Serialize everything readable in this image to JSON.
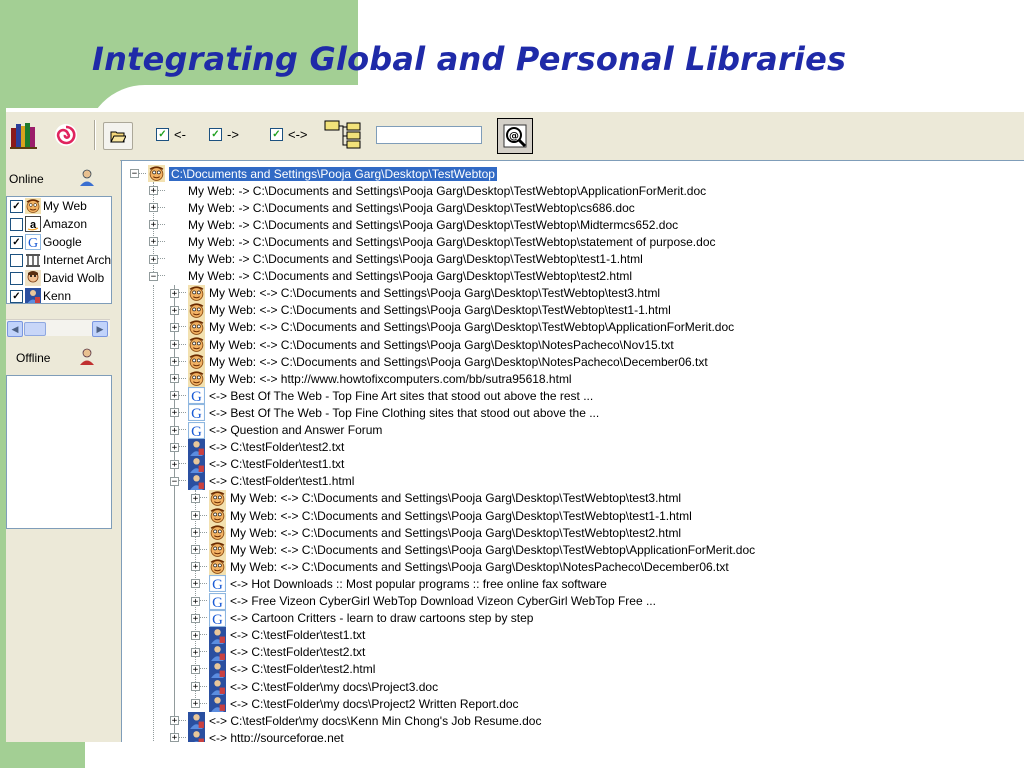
{
  "slide": {
    "title": "Integrating Global and Personal Libraries"
  },
  "toolbar": {
    "books_icon": "books-icon",
    "swirl_icon": "swirl-icon",
    "open_icon": "open-folder-icon",
    "check_left_label": "<-",
    "check_right_label": "->",
    "check_both_label": "<->",
    "tree_icon": "tree-view-icon",
    "search_value": "",
    "search_icon": "search-at-icon"
  },
  "left_panel": {
    "online_label": "Online",
    "offline_label": "Offline",
    "online_items": [
      {
        "label": "My Web",
        "checked": true,
        "icon": "myweb-face-icon"
      },
      {
        "label": "Amazon",
        "checked": false,
        "icon": "amazon-icon"
      },
      {
        "label": "Google",
        "checked": true,
        "icon": "google-icon"
      },
      {
        "label": "Internet Arch",
        "checked": false,
        "icon": "archive-icon"
      },
      {
        "label": "David Wolb",
        "checked": false,
        "icon": "person-icon"
      },
      {
        "label": "Kenn",
        "checked": true,
        "icon": "user-icon"
      }
    ]
  },
  "tree": {
    "rows": [
      {
        "level": 0,
        "exp": "-",
        "icon": "face",
        "text": "C:\\Documents and Settings\\Pooja Garg\\Desktop\\TestWebtop",
        "selected": true
      },
      {
        "level": 1,
        "exp": "+",
        "icon": "none",
        "text": "My Web:  -> C:\\Documents and Settings\\Pooja Garg\\Desktop\\TestWebtop\\ApplicationForMerit.doc"
      },
      {
        "level": 1,
        "exp": "+",
        "icon": "none",
        "text": "My Web:  -> C:\\Documents and Settings\\Pooja Garg\\Desktop\\TestWebtop\\cs686.doc"
      },
      {
        "level": 1,
        "exp": "+",
        "icon": "none",
        "text": "My Web:  -> C:\\Documents and Settings\\Pooja Garg\\Desktop\\TestWebtop\\Midtermcs652.doc"
      },
      {
        "level": 1,
        "exp": "+",
        "icon": "none",
        "text": "My Web:  -> C:\\Documents and Settings\\Pooja Garg\\Desktop\\TestWebtop\\statement of purpose.doc"
      },
      {
        "level": 1,
        "exp": "+",
        "icon": "none",
        "text": "My Web:  -> C:\\Documents and Settings\\Pooja Garg\\Desktop\\TestWebtop\\test1-1.html"
      },
      {
        "level": 1,
        "exp": "-",
        "icon": "none",
        "text": "My Web:  -> C:\\Documents and Settings\\Pooja Garg\\Desktop\\TestWebtop\\test2.html"
      },
      {
        "level": 2,
        "exp": "+",
        "icon": "face",
        "text": "My Web: <-> C:\\Documents and Settings\\Pooja Garg\\Desktop\\TestWebtop\\test3.html"
      },
      {
        "level": 2,
        "exp": "+",
        "icon": "face",
        "text": "My Web: <-> C:\\Documents and Settings\\Pooja Garg\\Desktop\\TestWebtop\\test1-1.html"
      },
      {
        "level": 2,
        "exp": "+",
        "icon": "face",
        "text": "My Web: <-> C:\\Documents and Settings\\Pooja Garg\\Desktop\\TestWebtop\\ApplicationForMerit.doc"
      },
      {
        "level": 2,
        "exp": "+",
        "icon": "face",
        "text": "My Web: <-> C:\\Documents and Settings\\Pooja Garg\\Desktop\\NotesPacheco\\Nov15.txt"
      },
      {
        "level": 2,
        "exp": "+",
        "icon": "face",
        "text": "My Web: <-> C:\\Documents and Settings\\Pooja Garg\\Desktop\\NotesPacheco\\December06.txt"
      },
      {
        "level": 2,
        "exp": "+",
        "icon": "face",
        "text": "My Web: <-> http://www.howtofixcomputers.com/bb/sutra95618.html"
      },
      {
        "level": 2,
        "exp": "+",
        "icon": "google",
        "text": "<-> Best Of The Web - Top Fine Art sites that stood out above the rest ..."
      },
      {
        "level": 2,
        "exp": "+",
        "icon": "google",
        "text": "<-> Best Of The Web - Top Fine Clothing sites that stood out above the ..."
      },
      {
        "level": 2,
        "exp": "+",
        "icon": "google",
        "text": "<-> Question and Answer Forum"
      },
      {
        "level": 2,
        "exp": "+",
        "icon": "user",
        "text": "<-> C:\\testFolder\\test2.txt"
      },
      {
        "level": 2,
        "exp": "+",
        "icon": "user",
        "text": "<-> C:\\testFolder\\test1.txt"
      },
      {
        "level": 2,
        "exp": "-",
        "icon": "user",
        "text": "<-> C:\\testFolder\\test1.html"
      },
      {
        "level": 3,
        "exp": "+",
        "icon": "face",
        "text": "My Web: <-> C:\\Documents and Settings\\Pooja Garg\\Desktop\\TestWebtop\\test3.html"
      },
      {
        "level": 3,
        "exp": "+",
        "icon": "face",
        "text": "My Web: <-> C:\\Documents and Settings\\Pooja Garg\\Desktop\\TestWebtop\\test1-1.html"
      },
      {
        "level": 3,
        "exp": "+",
        "icon": "face",
        "text": "My Web: <-> C:\\Documents and Settings\\Pooja Garg\\Desktop\\TestWebtop\\test2.html"
      },
      {
        "level": 3,
        "exp": "+",
        "icon": "face",
        "text": "My Web: <-> C:\\Documents and Settings\\Pooja Garg\\Desktop\\TestWebtop\\ApplicationForMerit.doc"
      },
      {
        "level": 3,
        "exp": "+",
        "icon": "face",
        "text": "My Web: <-> C:\\Documents and Settings\\Pooja Garg\\Desktop\\NotesPacheco\\December06.txt"
      },
      {
        "level": 3,
        "exp": "+",
        "icon": "google",
        "text": "<-> Hot Downloads :: Most popular programs :: free online fax software"
      },
      {
        "level": 3,
        "exp": "+",
        "icon": "google",
        "text": "<-> Free Vizeon CyberGirl WebTop Download Vizeon CyberGirl WebTop Free ..."
      },
      {
        "level": 3,
        "exp": "+",
        "icon": "google",
        "text": "<-> Cartoon Critters - learn to draw cartoons step by step"
      },
      {
        "level": 3,
        "exp": "+",
        "icon": "user",
        "text": "<-> C:\\testFolder\\test1.txt"
      },
      {
        "level": 3,
        "exp": "+",
        "icon": "user",
        "text": "<-> C:\\testFolder\\test2.txt"
      },
      {
        "level": 3,
        "exp": "+",
        "icon": "user",
        "text": "<-> C:\\testFolder\\test2.html"
      },
      {
        "level": 3,
        "exp": "+",
        "icon": "user",
        "text": "<-> C:\\testFolder\\my docs\\Project3.doc"
      },
      {
        "level": 3,
        "exp": "+",
        "icon": "user",
        "text": "<-> C:\\testFolder\\my docs\\Project2 Written Report.doc"
      },
      {
        "level": 2,
        "exp": "+",
        "icon": "user",
        "text": "<-> C:\\testFolder\\my docs\\Kenn Min Chong's Job Resume.doc"
      },
      {
        "level": 2,
        "exp": "+",
        "icon": "user",
        "text": "<-> http://sourceforge.net"
      }
    ]
  },
  "colors": {
    "slide_green": "#a3cf94",
    "title_blue": "#1f2aa8",
    "selection": "#316ac5",
    "window_bg": "#ece9d8"
  }
}
